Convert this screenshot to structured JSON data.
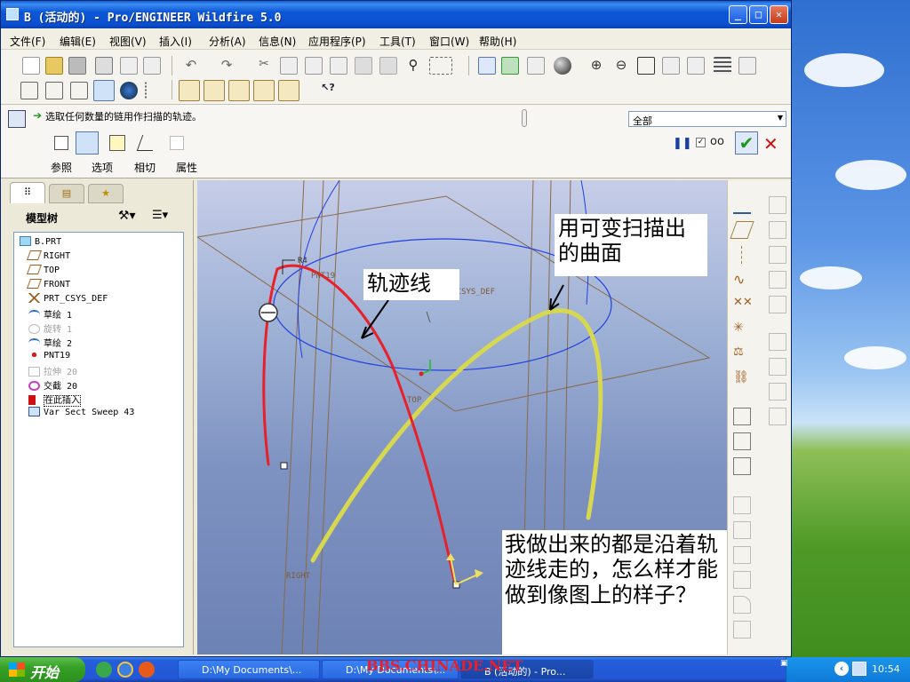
{
  "window": {
    "title": "B (活动的) - Pro/ENGINEER Wildfire 5.0",
    "controls": [
      "minimize",
      "maximize",
      "close"
    ]
  },
  "menu": [
    "文件(F)",
    "编辑(E)",
    "视图(V)",
    "插入(I)",
    "分析(A)",
    "信息(N)",
    "应用程序(P)",
    "工具(T)",
    "窗口(W)",
    "帮助(H)"
  ],
  "dashboard": {
    "message": "选取任何数量的链用作扫描的轨迹。",
    "filter_value": "全部",
    "tabs": [
      "参照",
      "选项",
      "相切",
      "属性"
    ]
  },
  "sidebar": {
    "title": "模型树",
    "items": [
      {
        "label": "B.PRT",
        "icon": "part-icon",
        "dim": false
      },
      {
        "label": "RIGHT",
        "icon": "datum-plane-icon",
        "dim": false
      },
      {
        "label": "TOP",
        "icon": "datum-plane-icon",
        "dim": false
      },
      {
        "label": "FRONT",
        "icon": "datum-plane-icon",
        "dim": false
      },
      {
        "label": "PRT_CSYS_DEF",
        "icon": "csys-icon",
        "dim": false
      },
      {
        "label": "草绘 1",
        "icon": "sketch-icon",
        "dim": false
      },
      {
        "label": "旋转 1",
        "icon": "revolve-icon",
        "dim": true
      },
      {
        "label": "草绘 2",
        "icon": "sketch-icon",
        "dim": false
      },
      {
        "label": "PNT19",
        "icon": "datum-point-icon",
        "dim": false
      },
      {
        "label": "拉伸 20",
        "icon": "extrude-icon",
        "dim": true
      },
      {
        "label": "交截 20",
        "icon": "intersect-icon",
        "dim": false
      },
      {
        "label": "在此插入",
        "icon": "insert-here-icon",
        "dim": false
      },
      {
        "label": "Var Sect Sweep 43",
        "icon": "sweep-icon",
        "dim": false
      }
    ]
  },
  "viewport": {
    "labels": {
      "pnt": "PNT19",
      "csys": "PRT_CSYS_DEF",
      "top": "TOP",
      "right": "RIGHT",
      "dim": "R4"
    },
    "annotations": {
      "trajectory": "轨迹线",
      "surface": "用可变扫描出的曲面",
      "question": "我做出来的都是沿着轨迹线走的，怎么样才能做到像图上的样子？"
    },
    "colors": {
      "trajectory": "#e8202a",
      "surface": "#d8d850",
      "datum": "#8a6a4a",
      "sketch": "#2040e0"
    }
  },
  "taskbar": {
    "start": "开始",
    "tasks": [
      "D:\\My Documents\\...",
      "D:\\My Documents\\...",
      "B (活动的) - Pro..."
    ],
    "watermark": "BBS.CHINADE.NET",
    "clock": "10:54"
  }
}
